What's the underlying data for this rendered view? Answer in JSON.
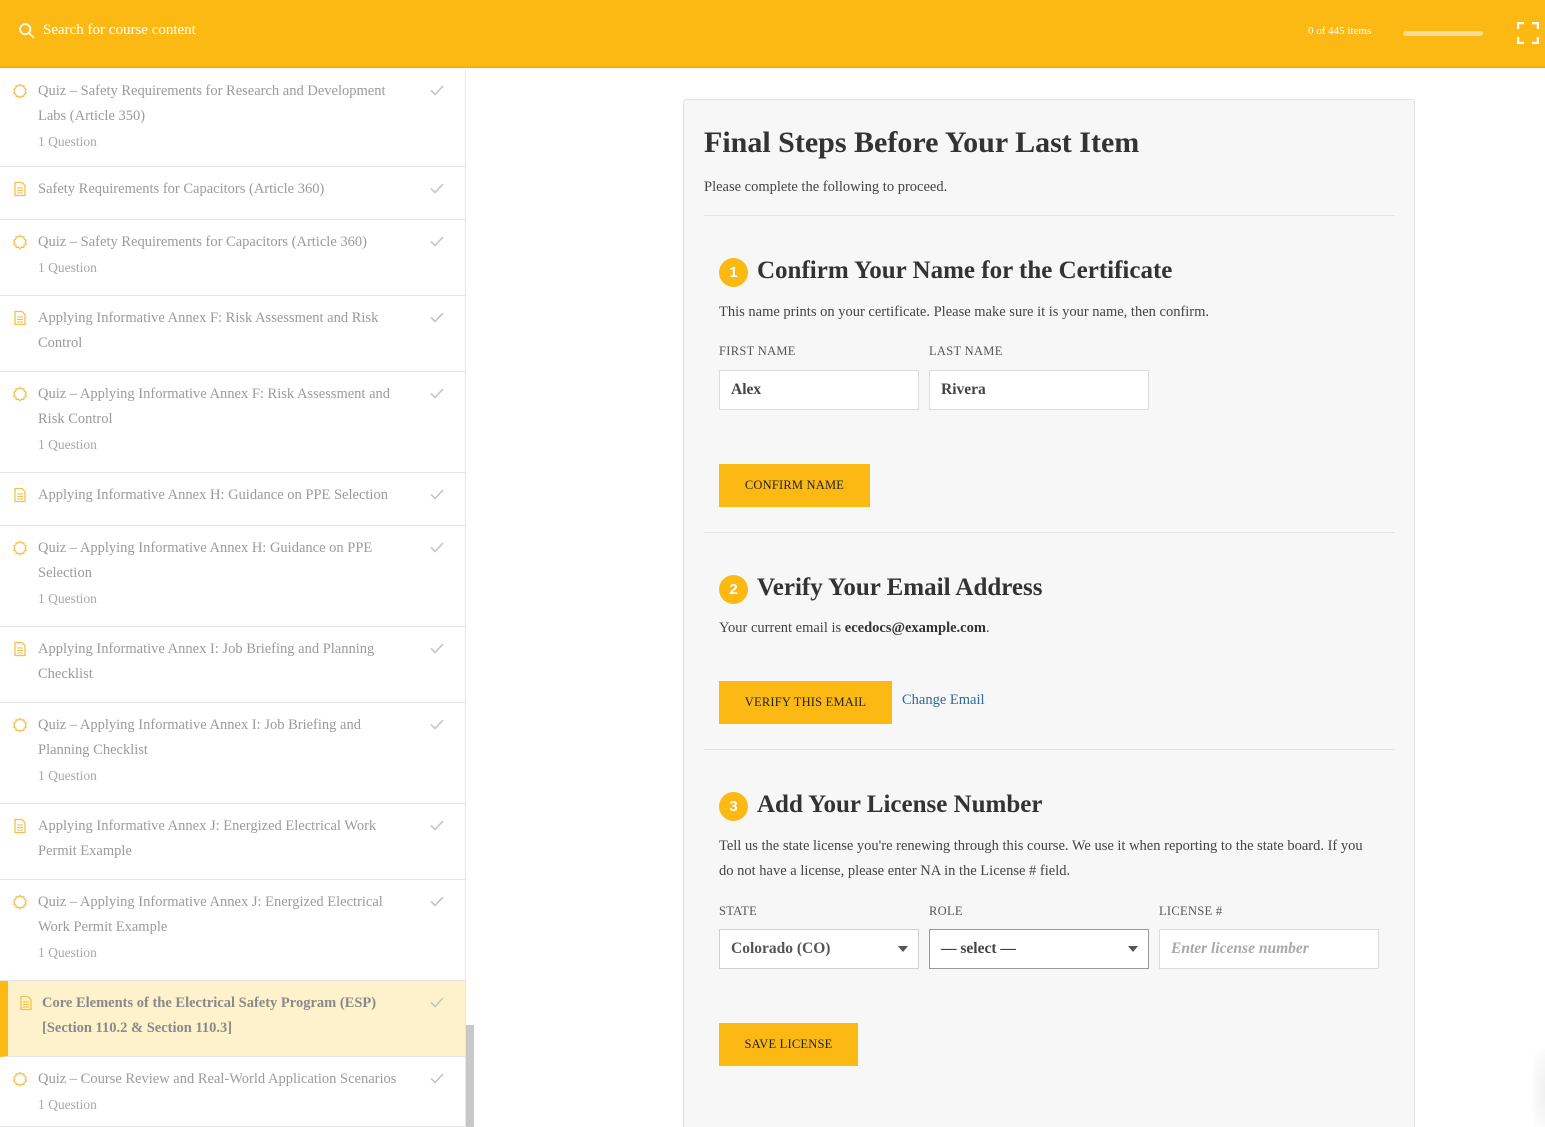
{
  "topbar": {
    "search_placeholder": "Search for course content",
    "progress_text": "0 of 445 items",
    "progress_fraction": 0.0
  },
  "sidebar": {
    "items": [
      {
        "type": "quiz",
        "title": "Quiz – Safety Requirements for Research and Development Labs (Article 350)",
        "sub": "1 Question"
      },
      {
        "type": "lesson",
        "title": "Safety Requirements for Capacitors (Article 360)",
        "sub": ""
      },
      {
        "type": "quiz",
        "title": "Quiz – Safety Requirements for Capacitors (Article 360)",
        "sub": "1 Question"
      },
      {
        "type": "lesson",
        "title": "Applying Informative Annex F: Risk Assessment and Risk Control",
        "sub": ""
      },
      {
        "type": "quiz",
        "title": "Quiz – Applying Informative Annex F: Risk Assessment and Risk Control",
        "sub": "1 Question"
      },
      {
        "type": "lesson",
        "title": "Applying Informative Annex H: Guidance on PPE Selection",
        "sub": ""
      },
      {
        "type": "quiz",
        "title": "Quiz – Applying Informative Annex H: Guidance on PPE Selection",
        "sub": "1 Question"
      },
      {
        "type": "lesson",
        "title": "Applying Informative Annex I: Job Briefing and Planning Checklist",
        "sub": ""
      },
      {
        "type": "quiz",
        "title": "Quiz – Applying Informative Annex I: Job Briefing and Planning Checklist",
        "sub": "1 Question"
      },
      {
        "type": "lesson",
        "title": "Applying Informative Annex J: Energized Electrical Work Permit Example",
        "sub": ""
      },
      {
        "type": "quiz",
        "title": "Quiz – Applying Informative Annex J: Energized Electrical Work Permit Example",
        "sub": "1 Question"
      },
      {
        "type": "lesson",
        "title": "Core Elements of the Electrical Safety Program (ESP) [Section 110.2 & Section 110.3]",
        "sub": "",
        "active": true
      },
      {
        "type": "quiz",
        "title": "Quiz – Course Review and Real-World Application Scenarios",
        "sub": "1 Question"
      }
    ]
  },
  "main": {
    "title": "Final Steps Before Your Last Item",
    "intro": "Please complete the following to proceed.",
    "step1": {
      "number": "1",
      "title": "Confirm Your Name for the Certificate",
      "text": "This name prints on your certificate. Please make sure it is your name, then confirm.",
      "first_label": "FIRST NAME",
      "first_value": "Alex",
      "last_label": "LAST NAME",
      "last_value": "Rivera",
      "button": "CONFIRM NAME"
    },
    "step2": {
      "number": "2",
      "title": "Verify Your Email Address",
      "text_prefix": "Your current email is ",
      "email": "ecedocs@example.com",
      "text_suffix": ".",
      "button": "VERIFY THIS EMAIL",
      "link": "Change Email"
    },
    "step3": {
      "number": "3",
      "title": "Add Your License Number",
      "text": "Tell us the state license you're renewing through this course. We use it when reporting to the state board. If you do not have a license, please enter NA in the License # field.",
      "state_label": "STATE",
      "state_value": "Colorado (CO)",
      "role_label": "ROLE",
      "role_value": "— select —",
      "license_label": "LICENSE #",
      "license_placeholder": "Enter license number",
      "button": "SAVE LICENSE"
    }
  },
  "colors": {
    "accent": "#fdb913",
    "link": "#2c6aa0",
    "active_bg": "#fef2cc"
  }
}
